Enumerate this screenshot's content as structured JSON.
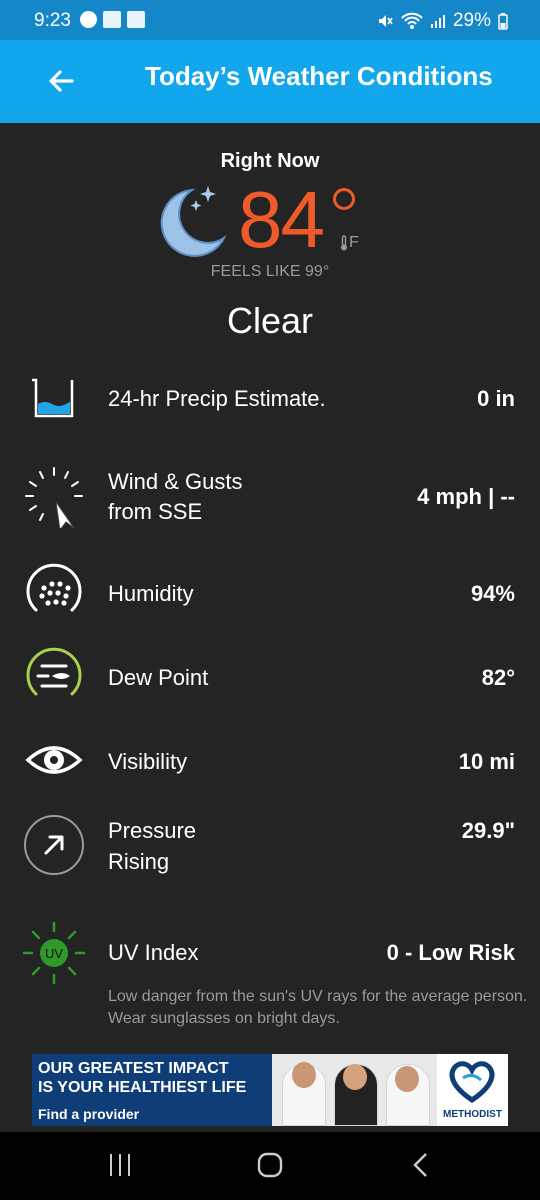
{
  "status_bar": {
    "time": "9:23",
    "battery": "29%"
  },
  "app_bar": {
    "title": "Today’s Weather Conditions",
    "back_icon": "arrow-left-icon"
  },
  "current": {
    "heading": "Right Now",
    "icon": "moon-stars-icon",
    "temperature": "84",
    "unit": "F",
    "feels_like": "FEELS LIKE 99°",
    "condition": "Clear"
  },
  "rows": [
    {
      "label": "24-hr Precip Estimate.",
      "value": "0 in",
      "icon": "precip-bucket-icon"
    },
    {
      "label": "Wind & Gusts",
      "label2": "from SSE",
      "value": "4 mph | --",
      "icon": "wind-direction-icon"
    },
    {
      "label": "Humidity",
      "value": "94%",
      "icon": "humidity-icon"
    },
    {
      "label": "Dew Point",
      "value": "82°",
      "icon": "dew-point-icon"
    },
    {
      "label": "Visibility",
      "value": "10 mi",
      "icon": "eye-icon"
    },
    {
      "label": "Pressure",
      "label2": "Rising",
      "value": "29.9\"",
      "icon": "pressure-arrow-icon"
    },
    {
      "label": "UV Index",
      "value": "0 - Low Risk",
      "icon": "uv-sun-icon",
      "badge": "UV",
      "description": "Low danger from the sun's UV rays for the average person. Wear sunglasses on bright days."
    }
  ],
  "ad": {
    "headline_1": "OUR GREATEST IMPACT",
    "headline_2": "IS YOUR HEALTHIEST LIFE",
    "cta": "Find a provider",
    "brand": "METHODIST"
  },
  "colors": {
    "app_bar": "#12a6ec",
    "status_bar": "#1587c9",
    "background": "#242424",
    "temperature": "#ee5a2a",
    "dew_point_ring": "#a8d04a",
    "uv_green": "#2e9a2a"
  }
}
